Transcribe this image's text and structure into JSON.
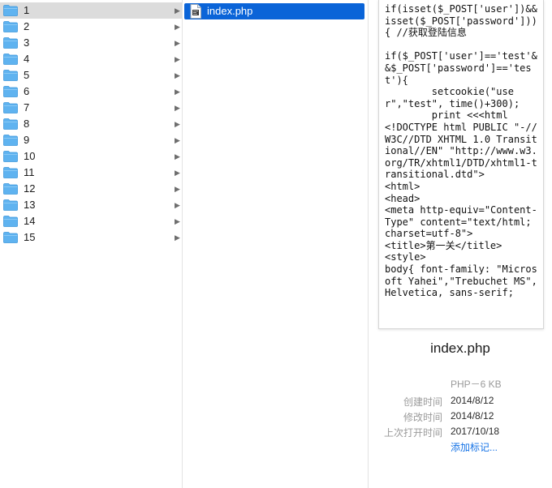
{
  "sidebar": {
    "folders": [
      {
        "label": "1",
        "selected": true
      },
      {
        "label": "2"
      },
      {
        "label": "3"
      },
      {
        "label": "4"
      },
      {
        "label": "5"
      },
      {
        "label": "6"
      },
      {
        "label": "7"
      },
      {
        "label": "8"
      },
      {
        "label": "9"
      },
      {
        "label": "10"
      },
      {
        "label": "11"
      },
      {
        "label": "12"
      },
      {
        "label": "13"
      },
      {
        "label": "14"
      },
      {
        "label": "15"
      }
    ]
  },
  "files": {
    "items": [
      {
        "label": "index.php",
        "selected": true
      }
    ]
  },
  "preview": {
    "code": "if(isset($_POST['user'])&&isset($_POST['password'])){ //获取登陆信息\n\nif($_POST['user']=='test'&&$_POST['password']=='test'){\n        setcookie(\"user\",\"test\", time()+300);\n        print <<<html\n<!DOCTYPE html PUBLIC \"-//W3C//DTD XHTML 1.0 Transitional//EN\" \"http://www.w3.org/TR/xhtml1/DTD/xhtml1-transitional.dtd\">\n<html>\n<head>\n<meta http-equiv=\"Content-Type\" content=\"text/html; charset=utf-8\">\n<title>第一关</title>\n<style>\nbody{ font-family: \"Microsoft Yahei\",\"Trebuchet MS\", Helvetica, sans-serif;",
    "file_name": "index.php",
    "kind_size": "PHP－6 KB",
    "created_label": "创建时间",
    "created_value": "2014/8/12",
    "modified_label": "修改时间",
    "modified_value": "2014/8/12",
    "opened_label": "上次打开时间",
    "opened_value": "2017/10/18",
    "add_tags": "添加标记..."
  },
  "colors": {
    "selection_active": "#0a64d8",
    "selection_inactive": "#dcdcdc",
    "folder": "#5fb3f0",
    "link": "#1673e6"
  }
}
